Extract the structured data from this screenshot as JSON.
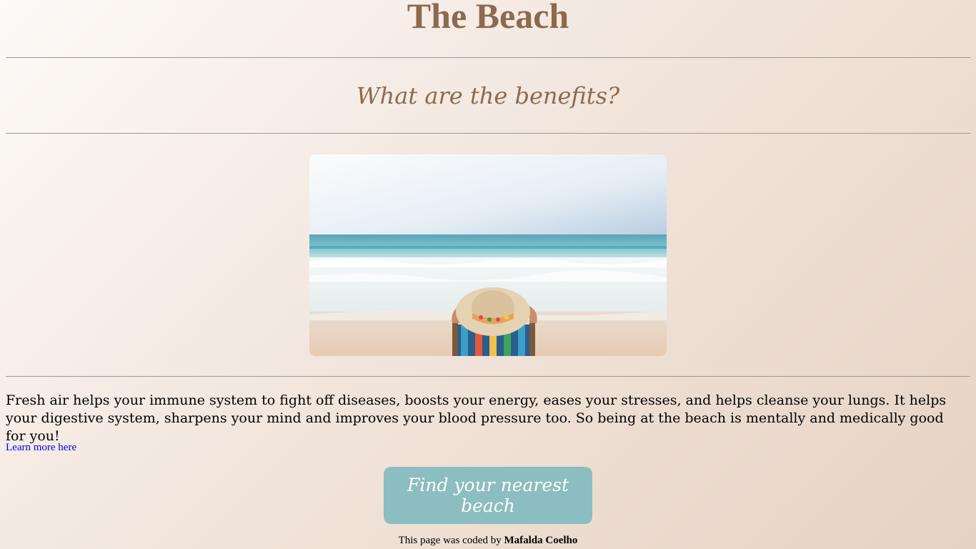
{
  "page": {
    "title": "The Beach",
    "subtitle": "What are the benefits?",
    "hero_image": {
      "alt": "Woman in a straw hat relaxing on a striped beach chair facing the sea"
    },
    "body": "Fresh air helps your immune system to fight off diseases, boosts your energy, eases your stresses, and helps cleanse your lungs. It helps your digestive system, sharpens your mind and improves your blood pressure too. So being at the beach is mentally and medically good for you!",
    "learn_more_link": "Learn more here",
    "cta_button": "Find your nearest beach",
    "footer": {
      "prefix": "This page was coded by",
      "author": "Mafalda Coelho"
    }
  },
  "colors": {
    "heading": "#8c6a4f",
    "button_bg": "#8cbdc1",
    "button_text": "#ffffff",
    "link": "#0000ee",
    "rule": "#9a9a9a"
  }
}
